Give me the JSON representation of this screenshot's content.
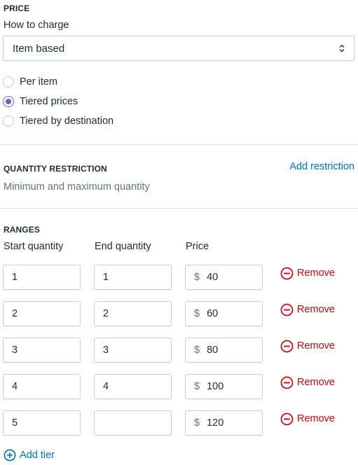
{
  "price": {
    "section_title": "PRICE",
    "how_to_charge_label": "How to charge",
    "charge_select_value": "Item based",
    "options": [
      {
        "label": "Per item",
        "checked": false
      },
      {
        "label": "Tiered prices",
        "checked": true
      },
      {
        "label": "Tiered by destination",
        "checked": false
      }
    ]
  },
  "quantity_restriction": {
    "section_title": "QUANTITY RESTRICTION",
    "add_link": "Add restriction",
    "description": "Minimum and maximum quantity"
  },
  "ranges": {
    "section_title": "RANGES",
    "headers": {
      "start": "Start quantity",
      "end": "End quantity",
      "price": "Price"
    },
    "currency_symbol": "$",
    "remove_label": "Remove",
    "add_tier_label": "Add tier",
    "rows": [
      {
        "start": "1",
        "end": "1",
        "price": "40"
      },
      {
        "start": "2",
        "end": "2",
        "price": "60"
      },
      {
        "start": "3",
        "end": "3",
        "price": "80"
      },
      {
        "start": "4",
        "end": "4",
        "price": "100"
      },
      {
        "start": "5",
        "end": "",
        "price": "120"
      }
    ]
  },
  "colors": {
    "accent": "#5c6ac4",
    "link": "#006fbb",
    "destructive": "#bf0711",
    "border": "#c4cdd5",
    "subdued_text": "#637381"
  },
  "icons": {
    "select_caret": "select-caret-icon",
    "remove": "minus-circle-icon",
    "add": "plus-circle-icon"
  }
}
